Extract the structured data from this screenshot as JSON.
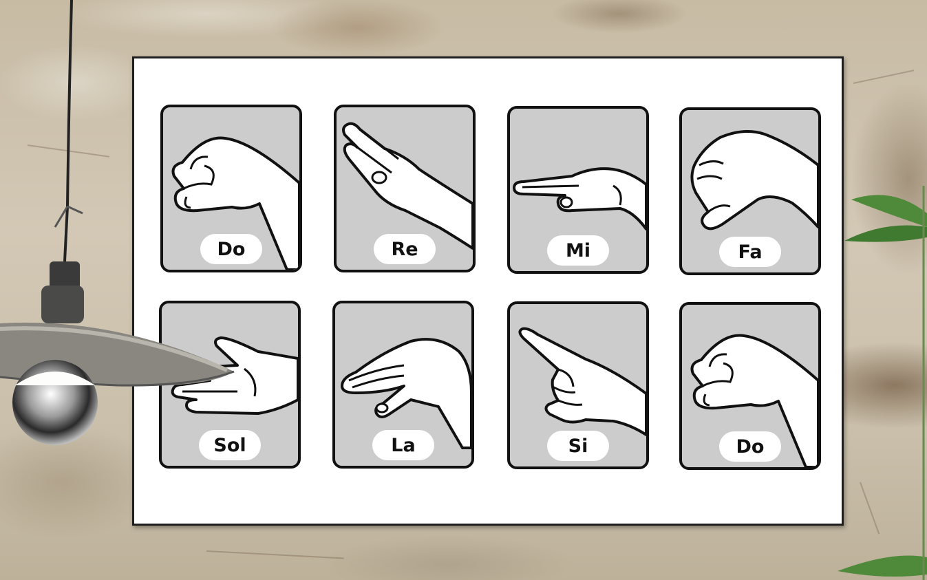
{
  "poster": {
    "cards": [
      {
        "label": "Do",
        "hand": "fist-thumb-hand-icon"
      },
      {
        "label": "Re",
        "hand": "angled-flat-hand-icon"
      },
      {
        "label": "Mi",
        "hand": "flat-hand-icon"
      },
      {
        "label": "Fa",
        "hand": "thumb-down-fist-hand-icon"
      },
      {
        "label": "Sol",
        "hand": "open-palm-hand-icon"
      },
      {
        "label": "La",
        "hand": "cupped-hand-icon"
      },
      {
        "label": "Si",
        "hand": "pointing-hand-icon"
      },
      {
        "label": "Do",
        "hand": "fist-thumb-hand-icon"
      }
    ]
  },
  "colors": {
    "card_background": "#cccccc",
    "card_border": "#111111",
    "label_pill": "#ffffff",
    "poster_background": "#ffffff"
  }
}
